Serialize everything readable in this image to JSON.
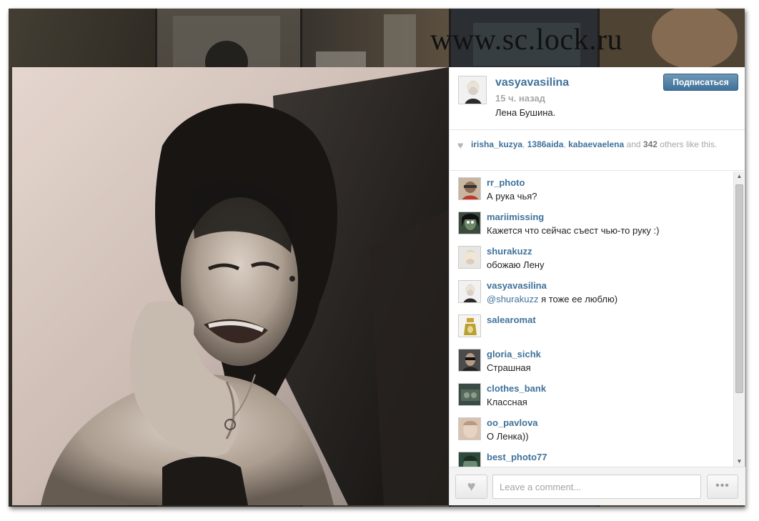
{
  "watermark": "www.sc.lock.ru",
  "post": {
    "username": "vasyavasilina",
    "time_ago": "15 ч. назад",
    "caption": "Лена Бушина.",
    "follow_label": "Подписаться"
  },
  "likes": {
    "users": [
      "irisha_kuzya",
      "1386aida",
      "kabaevaelena"
    ],
    "and_label": "and",
    "count": "342",
    "suffix": "others like this."
  },
  "comments": [
    {
      "user": "rr_photo",
      "text": "А рука чья?"
    },
    {
      "user": "mariimissing",
      "text": "Кажется что сейчас съест чью-то руку :)"
    },
    {
      "user": "shurakuzz",
      "text": "обожаю Лену"
    },
    {
      "user": "vasyavasilina",
      "mention": "@shurakuzz",
      "text": " я тоже ее люблю)"
    },
    {
      "user": "salearomat",
      "text": ""
    },
    {
      "user": "gloria_sichk",
      "text": "Страшная"
    },
    {
      "user": "clothes_bank",
      "text": "Классная"
    },
    {
      "user": "oo_pavlova",
      "text": "О Ленка))"
    },
    {
      "user": "best_photo77",
      "text": ""
    }
  ],
  "footer": {
    "placeholder": "Leave a comment...",
    "more_label": "•••"
  },
  "colors": {
    "link": "#3f729b",
    "muted": "#a5a7aa"
  },
  "icons": {
    "heart": "heart-icon",
    "more": "more-icon",
    "scroll_up": "scroll-up-icon",
    "scroll_down": "scroll-down-icon"
  }
}
